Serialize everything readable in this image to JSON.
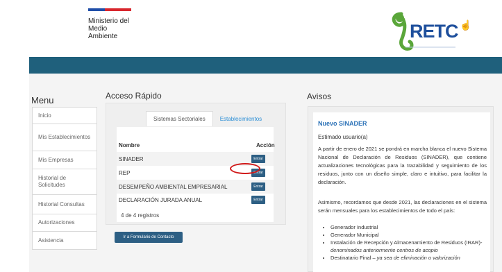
{
  "header": {
    "ministry": "Ministerio del\nMedio\nAmbiente",
    "logo_text": "RETC"
  },
  "menu": {
    "title": "Menu",
    "items": [
      "Inicio",
      "Mis Establecimientos",
      "Mis Empresas",
      "Historial de Solicitudes",
      "Historial Consultas",
      "Autorizaciones",
      "Asistencia"
    ]
  },
  "acceso": {
    "title": "Acceso Rápido",
    "tabs": [
      "Sistemas Sectoriales",
      "Establecimientos"
    ],
    "col_nombre": "Nombre",
    "col_accion": "Acción",
    "rows": [
      "SINADER",
      "REP",
      "DESEMPEÑO AMBIENTAL EMPRESARIAL",
      "DECLARACIÓN JURADA ANUAL"
    ],
    "enter_label": "Entrar",
    "count": "4 de 4 registros",
    "contact_button": "Ir a Formulario de Contacto"
  },
  "avisos": {
    "title": "Avisos",
    "heading": "Nuevo SINADER",
    "greeting": "Estimado usuario(a)",
    "p1": "A partir de enero de 2021 se pondrá en marcha blanca el nuevo Sistema Nacional de Declaración de Residuos (SINADER), que contiene actualizaciones tecnológicas para la trazabilidad y seguimiento de los residuos, junto con un diseño simple, claro e intuitivo, para facilitar la declaración.",
    "p2": "Asimismo, recordamos que desde 2021, las declaraciones en el sistema serán mensuales para los establecimientos de todo el país:",
    "bullets": [
      "Generador Industrial",
      "Generador Municipal",
      "Instalación de Recepción y Almacenamiento de Residuos (IRAR)-",
      "denominados anteriormente centros de acopio",
      "Destinatario Final –",
      "ya sea de eliminación o valorización"
    ]
  },
  "colors": {
    "bar": "#1f607c",
    "button": "#2d5f84",
    "link": "#2a8ed6",
    "highlight": "#d01818"
  },
  "icons": [
    "pointer-cursor-icon",
    "retc-logo-icon",
    "chile-flag-stripe-icon"
  ]
}
